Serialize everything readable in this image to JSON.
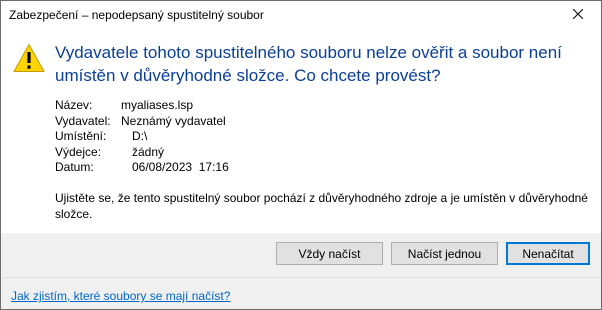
{
  "dialog": {
    "title": "Zabezpečení – nepodepsaný spustitelný soubor",
    "icon": "warning-icon",
    "heading": "Vydavatele tohoto spustitelného souboru nelze ověřit a soubor není umístěn v důvěryhodné složce. Co chcete provést?",
    "details": [
      {
        "label": "Název:",
        "value": "myaliases.lsp"
      },
      {
        "label": "Vydavatel:",
        "value": "Neznámý vydavatel"
      },
      {
        "label": "Umístění:",
        "value": "D:\\"
      },
      {
        "label": "Výdejce:",
        "value": "žádný"
      },
      {
        "label": "Datum:",
        "value": "06/08/2023  17:16"
      }
    ],
    "message": "Ujistěte se, že tento spustitelný soubor pochází z důvěryhodného zdroje a je umístěn v důvěryhodné složce.",
    "buttons": {
      "always_load": "Vždy načíst",
      "load_once": "Načíst jednou",
      "do_not_load": "Nenačítat"
    },
    "help_link": "Jak zjistím, které soubory se mají načíst?"
  },
  "colors": {
    "heading": "#0b3f97",
    "link": "#0066cc",
    "default_button_border": "#0078d7",
    "footer_background": "#f0f0f0"
  }
}
